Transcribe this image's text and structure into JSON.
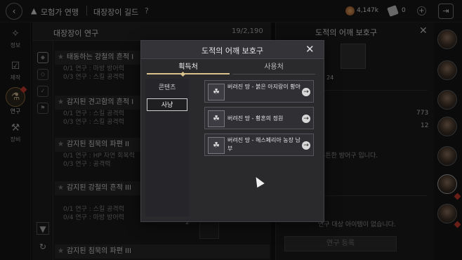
{
  "topbar": {
    "back_icon": "back-arrow-icon",
    "crumb1": "모험가 연맹",
    "crumb2": "대장장이 길드",
    "help": "?",
    "currency1": "4,147k",
    "currency2": "0",
    "plus": "+"
  },
  "nav": {
    "items": [
      {
        "label": "정보",
        "icon": "compass-icon"
      },
      {
        "label": "제작",
        "icon": "checklist-icon"
      },
      {
        "label": "연구",
        "icon": "research-icon"
      },
      {
        "label": "장비",
        "icon": "equipment-icon"
      }
    ]
  },
  "list": {
    "title": "대장장이 연구",
    "count": "19/2,190",
    "quests": [
      {
        "title": "태동하는 강철의 흔적 I",
        "subs": [
          "0/1 연구 : 마방 방어력",
          "0/3 연구 : 스킬 공격력"
        ]
      },
      {
        "title": "감지된 견고함의 흔적 I",
        "subs": [
          "0/1 연구 : 스킬 공격력",
          "0/3 연구 : 스킬 공격력"
        ]
      },
      {
        "title": "감지된 침묵의 파편 II",
        "subs": [
          "0/1 연구 : HP 자연 회복력",
          "0/3 연구 : 공격력"
        ]
      },
      {
        "title": "감지된 강철의 흔적 III",
        "subs": [
          "0/1 연구 : 스킬 공격력",
          "0/4 연구 : 마방 방어력"
        ]
      },
      {
        "title": "감지된 침묵의 파편 III",
        "subs": []
      }
    ],
    "slot_count": "2"
  },
  "detail": {
    "title": "도적의 어깨 보호구",
    "num1": "24",
    "stat1": "773",
    "stat2": "12",
    "desc": "튼튼한 방어구 입니다.",
    "empty": "연구 대상 아이템이 없습니다.",
    "button": "연구 등록"
  },
  "modal": {
    "title": "도적의 어깨 보호구",
    "tab_source": "획득처",
    "tab_usage": "사용처",
    "categories": [
      "콘텐츠",
      "사냥"
    ],
    "locations": [
      {
        "name": "버려진 땅 - 붉은 아지랑이 황야"
      },
      {
        "name": "버려진 땅 - 황혼의 정원"
      },
      {
        "name": "버려진 땅 - 헤스페리아 농장 남부"
      }
    ]
  },
  "colors": {
    "accent": "#d9c28b",
    "badge_red": "#c0392b"
  }
}
